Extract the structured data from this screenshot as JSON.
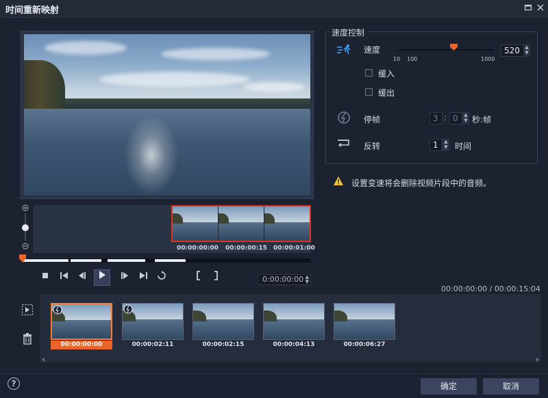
{
  "window": {
    "title": "时间重新映射",
    "maximize_icon": "maximize-icon",
    "close_icon": "close-icon"
  },
  "preview": {
    "timeline_thumbs": [
      {
        "timecode": "00:00:00:00"
      },
      {
        "timecode": "00:00:00:15"
      },
      {
        "timecode": "00:00:01:00"
      }
    ],
    "timecode_value": "0:00:00:00"
  },
  "speed_control": {
    "group_title": "速度控制",
    "speed_label": "速度",
    "speed_value": "520",
    "speed_scale": [
      "10",
      "100",
      "1000"
    ],
    "ease_in_label": "缓入",
    "ease_out_label": "缓出",
    "freeze_label": "停帧",
    "freeze_seconds": "3",
    "freeze_separator": ":",
    "freeze_frames": "0",
    "freeze_unit": "秒:帧",
    "reverse_label": "反转",
    "reverse_value": "1",
    "reverse_unit": "时间"
  },
  "warning": {
    "text": "设置变速将会删除视频片段中的音频。"
  },
  "total_time": "00:00:00:00 / 00:00:15:04",
  "clips": [
    {
      "timecode": "00:00:00:00",
      "selected": true
    },
    {
      "timecode": "00:00:02:11",
      "selected": false
    },
    {
      "timecode": "00:00:02:15",
      "selected": false
    },
    {
      "timecode": "00:00:04:13",
      "selected": false
    },
    {
      "timecode": "00:00:06:27",
      "selected": false
    }
  ],
  "footer": {
    "ok_label": "确定",
    "cancel_label": "取消",
    "help_label": "?"
  },
  "colors": {
    "accent": "#e8642a",
    "selection_border": "#e0321f",
    "speed_icon": "#3aa4ff"
  }
}
